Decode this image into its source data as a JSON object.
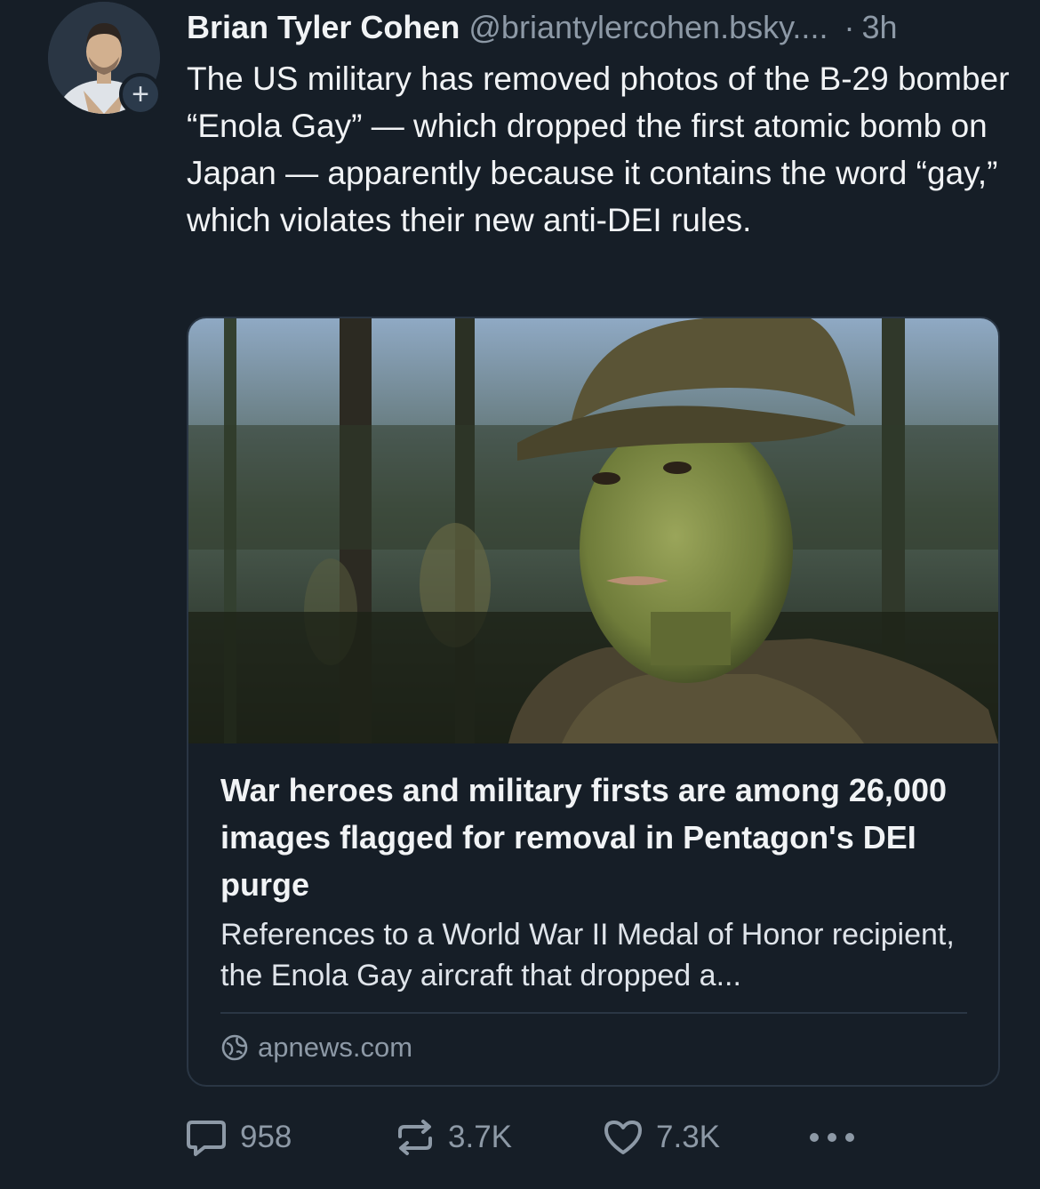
{
  "post": {
    "author": {
      "name": "Brian Tyler Cohen",
      "handle": "@briantylercohen.bsky....",
      "follow_icon": "plus-icon",
      "follow_glyph": "+"
    },
    "separator": "·",
    "time": "3h",
    "text": "The US military has removed photos of the B-29 bomber “Enola Gay” — which dropped the first atomic bomb on Japan — apparently because it contains the word “gay,” which violates their new anti-DEI rules."
  },
  "link_card": {
    "title": "War heroes and military firsts are among 26,000 images flagged for removal in Pentagon's DEI purge",
    "description": "References to a World War II Medal of Honor recipient, the Enola Gay aircraft that dropped a...",
    "domain": "apnews.com",
    "domain_icon": "globe-icon"
  },
  "actions": {
    "reply": {
      "icon": "reply-icon",
      "count": "958"
    },
    "repost": {
      "icon": "repost-icon",
      "count": "3.7K"
    },
    "like": {
      "icon": "heart-icon",
      "count": "7.3K"
    },
    "more": {
      "icon": "more-icon"
    }
  },
  "colors": {
    "background": "#161e27",
    "text_primary": "#f1f3f5",
    "text_muted": "#8d99a6",
    "border": "#2a3644"
  }
}
